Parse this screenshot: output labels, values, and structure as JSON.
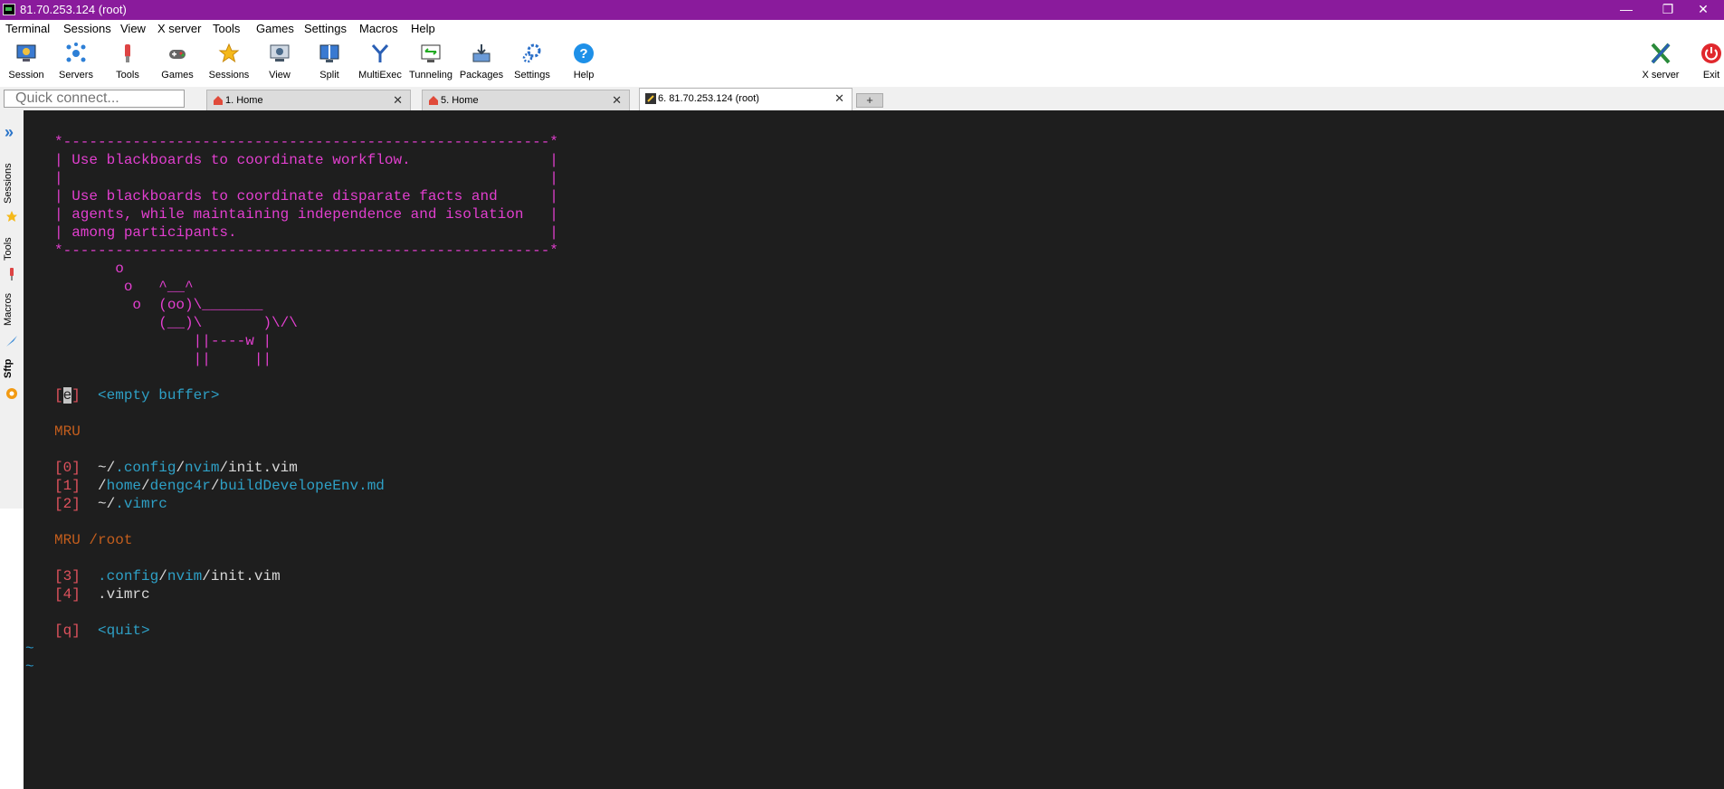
{
  "window": {
    "title": "81.70.253.124 (root)",
    "minimize": "—",
    "restore": "❐",
    "close": "✕"
  },
  "menubar": [
    "Terminal",
    "Sessions",
    "View",
    "X server",
    "Tools",
    "Games",
    "Settings",
    "Macros",
    "Help"
  ],
  "toolbar": {
    "left": [
      {
        "label": "Session",
        "icon": "session-icon"
      },
      {
        "label": "Servers",
        "icon": "servers-icon"
      },
      {
        "label": "Tools",
        "icon": "tools-icon"
      },
      {
        "label": "Games",
        "icon": "games-icon"
      },
      {
        "label": "Sessions",
        "icon": "star-icon"
      },
      {
        "label": "View",
        "icon": "view-icon"
      },
      {
        "label": "Split",
        "icon": "split-icon"
      },
      {
        "label": "MultiExec",
        "icon": "multiexec-icon"
      },
      {
        "label": "Tunneling",
        "icon": "tunneling-icon"
      },
      {
        "label": "Packages",
        "icon": "packages-icon"
      },
      {
        "label": "Settings",
        "icon": "gear-icon"
      },
      {
        "label": "Help",
        "icon": "help-icon"
      }
    ],
    "xserver": "X server",
    "exit": "Exit"
  },
  "quick_connect": {
    "placeholder": "Quick connect..."
  },
  "tabs": [
    {
      "label": "1. Home",
      "close": "✕",
      "active": false
    },
    {
      "label": "5. Home",
      "close": "✕",
      "active": false
    },
    {
      "label": "6. 81.70.253.124 (root)",
      "close": "✕",
      "active": true
    }
  ],
  "new_tab": "+",
  "sidebar": {
    "tabs": [
      "Sessions",
      "Tools",
      "Macros",
      "Sftp"
    ]
  },
  "terminal": {
    "banner": [
      "*--------------------------------------------------------*",
      "| Use blackboards to coordinate workflow.                |",
      "|                                                        |",
      "| Use blackboards to coordinate disparate facts and      |",
      "| agents, while maintaining independence and isolation   |",
      "| among participants.                                    |",
      "*--------------------------------------------------------*"
    ],
    "cow": [
      "       o",
      "        o   ^__^",
      "         o  (oo)\\_______",
      "            (__)\\       )\\/\\",
      "                ||----w |",
      "                ||     ||"
    ],
    "entries": {
      "e_open": "[",
      "e_key": "e",
      "e_close": "]",
      "e_label": "<empty buffer>",
      "mru_header": "MRU",
      "mru": [
        {
          "key": "[0]",
          "pre": "~/",
          "dir1": ".config",
          "sep1": "/",
          "dir2": "nvim",
          "sep2": "/",
          "file": "init.vim"
        },
        {
          "key": "[1]",
          "pre": "/",
          "dir1": "home",
          "sep1": "/",
          "dir2": "dengc4r",
          "sep2": "/",
          "file": "buildDevelopeEnv.md"
        },
        {
          "key": "[2]",
          "pre": "~/",
          "dir1": "",
          "sep1": "",
          "dir2": "",
          "sep2": "",
          "file": ".vimrc"
        }
      ],
      "mru_root_header": "MRU /root",
      "mru_root": [
        {
          "key": "[3]",
          "dir1": ".config",
          "sep1": "/",
          "dir2": "nvim",
          "sep2": "/",
          "file": "init.vim"
        },
        {
          "key": "[4]",
          "dir1": "",
          "sep1": "",
          "dir2": "",
          "sep2": "",
          "file": ".vimrc"
        }
      ],
      "quit_key": "[q]",
      "quit_label": "<quit>"
    },
    "tilde": "~"
  },
  "colors": {
    "titlebar": "#8a1b9c",
    "terminal_bg": "#1e1e1e",
    "magenta": "#e23fcf",
    "cyan": "#2ea0c6",
    "orange": "#c45e1d",
    "red": "#e0525d"
  }
}
